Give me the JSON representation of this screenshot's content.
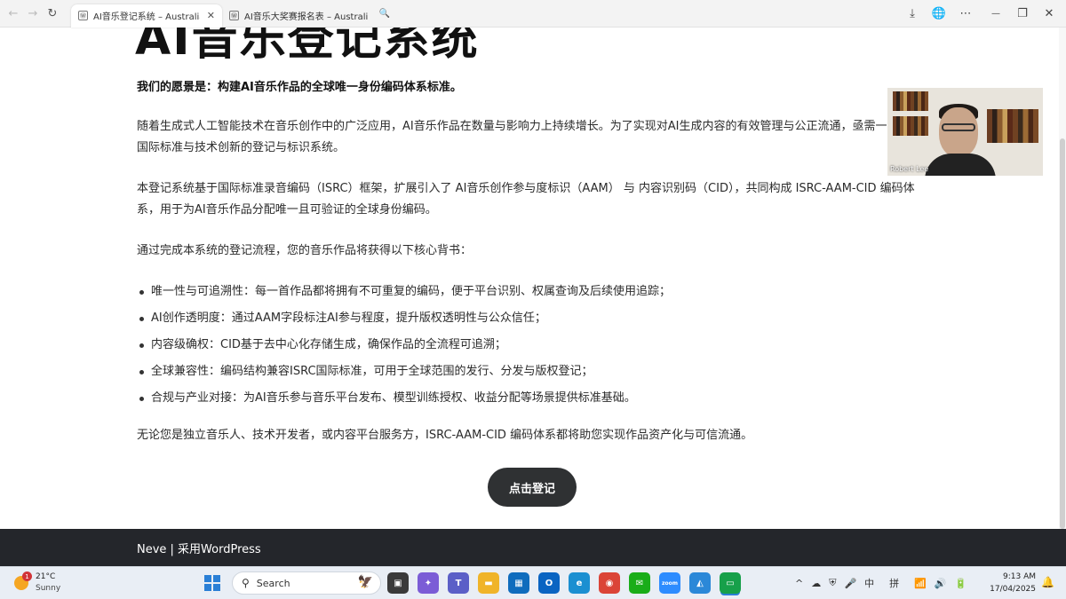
{
  "browser": {
    "tabs": [
      {
        "title": "AI音乐登记系统 – Australian A",
        "favicon": "Ⓦ"
      },
      {
        "title": "AI音乐大奖赛报名表 – Australian A",
        "favicon": "Ⓦ"
      }
    ],
    "close_glyph": "✕",
    "nav": {
      "back": "←",
      "forward": "→",
      "reload": "↻",
      "search": "🔍"
    },
    "right_icons": {
      "download": "⤓",
      "globe": "🌐",
      "more": "⋯",
      "minimize": "—",
      "restore": "❐",
      "close": "✕"
    }
  },
  "page": {
    "heading": "AI音乐登记系统",
    "vision": "我们的愿景是：构建AI音乐作品的全球唯一身份编码体系标准。",
    "para1": "随着生成式人工智能技术在音乐创作中的广泛应用，AI音乐作品在数量与影响力上持续增长。为了实现对AI生成内容的有效管理与公正流通，亟需一套兼具国际标准与技术创新的登记与标识系统。",
    "para2": "本登记系统基于国际标准录音编码（ISRC）框架，扩展引入了 AI音乐创作参与度标识（AAM） 与 内容识别码（CID），共同构成 ISRC-AAM-CID 编码体系，用于为AI音乐作品分配唯一且可验证的全球身份编码。",
    "para3": "通过完成本系统的登记流程，您的音乐作品将获得以下核心背书：",
    "bullets": [
      "唯一性与可追溯性：每一首作品都将拥有不可重复的编码，便于平台识别、权属查询及后续使用追踪；",
      "AI创作透明度：通过AAM字段标注AI参与程度，提升版权透明性与公众信任；",
      "内容级确权：CID基于去中心化存储生成，确保作品的全流程可追溯；",
      "全球兼容性：编码结构兼容ISRC国际标准，可用于全球范围的发行、分发与版权登记；",
      "合规与产业对接：为AI音乐参与音乐平台发布、模型训练授权、收益分配等场景提供标准基础。"
    ],
    "closing": "无论您是独立音乐人、技术开发者，或内容平台服务方，ISRC-AAM-CID 编码体系都将助您实现作品资产化与可信流通。",
    "cta_label": "点击登记"
  },
  "video": {
    "name": "Robert Lee"
  },
  "footer": {
    "text": "Neve | 采用WordPress"
  },
  "taskbar": {
    "weather": {
      "temp": "21°C",
      "condition": "Sunny",
      "badge": "1"
    },
    "search_placeholder": "Search",
    "search_deco": "🦅",
    "apps": [
      {
        "name": "task-view",
        "glyph": "▣",
        "color": "#3a3a3a"
      },
      {
        "name": "copilot",
        "glyph": "✦",
        "color": "#7b5cd6"
      },
      {
        "name": "teams",
        "glyph": "T",
        "color": "#5b5fc7"
      },
      {
        "name": "file-explorer",
        "glyph": "▬",
        "color": "#f0b429"
      },
      {
        "name": "store",
        "glyph": "▦",
        "color": "#0f6cbd"
      },
      {
        "name": "outlook",
        "glyph": "O",
        "color": "#0a64c2"
      },
      {
        "name": "edge",
        "glyph": "e",
        "color": "#1b8fd1"
      },
      {
        "name": "chrome",
        "glyph": "◉",
        "color": "#db4437"
      },
      {
        "name": "wechat",
        "glyph": "✉",
        "color": "#1aad19"
      },
      {
        "name": "zoom",
        "glyph": "zoom",
        "color": "#2d8cff"
      },
      {
        "name": "photos",
        "glyph": "◭",
        "color": "#2b88d8"
      },
      {
        "name": "active-app",
        "glyph": "▭",
        "color": "#17a04a"
      }
    ],
    "tray": {
      "chevron": "^",
      "cloud": "☁",
      "shield": "⛨",
      "mic": "🎤",
      "ime1": "中",
      "ime2": "拼",
      "wifi": "📶",
      "volume": "🔊",
      "battery": "🔋"
    },
    "time": "9:13 AM",
    "date": "17/04/2025",
    "bell": "🔔"
  }
}
